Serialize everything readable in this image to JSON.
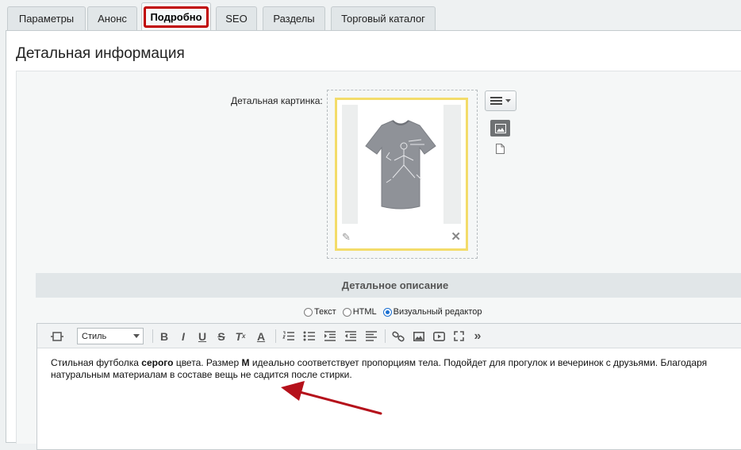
{
  "tabs": [
    {
      "label": "Параметры"
    },
    {
      "label": "Анонс"
    },
    {
      "label": "Подробно"
    },
    {
      "label": "SEO"
    },
    {
      "label": "Разделы"
    },
    {
      "label": "Торговый каталог"
    }
  ],
  "section": {
    "title": "Детальная информация"
  },
  "picture": {
    "label": "Детальная картинка:"
  },
  "description": {
    "header": "Детальное описание",
    "modes": [
      {
        "label": "Текст"
      },
      {
        "label": "HTML"
      },
      {
        "label": "Визуальный редактор",
        "selected": true
      }
    ]
  },
  "toolbar": {
    "style_select": "Стиль"
  },
  "editor": {
    "text_1": "Стильная футболка ",
    "bold_1": "серого",
    "text_2": " цвета. Размер ",
    "bold_2": "М",
    "text_3": " идеально соответствует пропорциям тела. Подойдет для прогулок и вечеринок с друзьями. Благодаря натуральным материалам в составе вещь не садится после стирки."
  },
  "colors": {
    "active_tab_outline": "#c00000",
    "arrow": "#b5111b",
    "image_frame": "#f3dc6a"
  }
}
